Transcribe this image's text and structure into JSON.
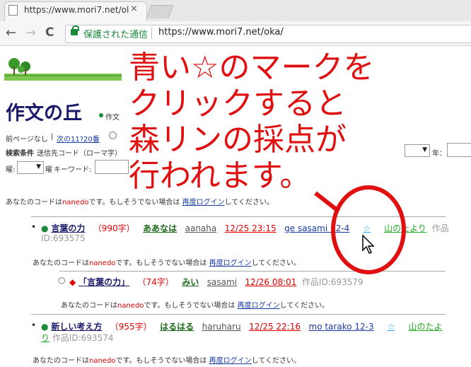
{
  "browser": {
    "tab_title": "https://www.mori7.net/ol",
    "tab_close": "×",
    "back": "←",
    "forward": "→",
    "reload": "C",
    "secure_label": "保護された通信",
    "url": "https://www.mori7.net/oka/"
  },
  "header": {
    "site_title": "作文の丘",
    "title_sub": "作文",
    "nav_prev": "前ページなし",
    "nav_sep": "|",
    "nav_next": "次の11?20番",
    "search_conditions_label": "検索条件",
    "search_target": "送信先コード（ローマ字）",
    "year_label": "年：",
    "weekday_label": "曜",
    "keyword_label": "キーワード:"
  },
  "login_notice": {
    "prefix": "あなたのコードは",
    "code": "nanedo",
    "middle": "です。もしそうでない場合は",
    "relogin": "再度ログイン",
    "suffix": "してください。"
  },
  "posts": [
    {
      "title": "言葉の力",
      "count": "（990字）",
      "author": "ああなは",
      "user": "aanaha",
      "date": "12/25 23:15",
      "scorer": "ge sasami 12-4",
      "star": "☆",
      "scorer2": "山のたより",
      "id_prefix": "作品",
      "id_value": "ID:693575"
    },
    {
      "title": "「言葉の力」",
      "count": "（74字）",
      "author": "みい",
      "user": "sasami",
      "date": "12/26 08:01",
      "id": "作品ID:693579"
    },
    {
      "title": "新しい考え方",
      "count": "（955字）",
      "author": "はるはる",
      "user": "haruharu",
      "date": "12/25 22:16",
      "scorer": "mo tarako 12-3",
      "star": "☆",
      "scorer2": "山のたよ",
      "scorer2_cont": "り",
      "id": "作品ID:693574"
    }
  ],
  "overlay": {
    "text": "青い☆のマークを\nクリックすると\n森リンの採点が\n行われます。"
  }
}
